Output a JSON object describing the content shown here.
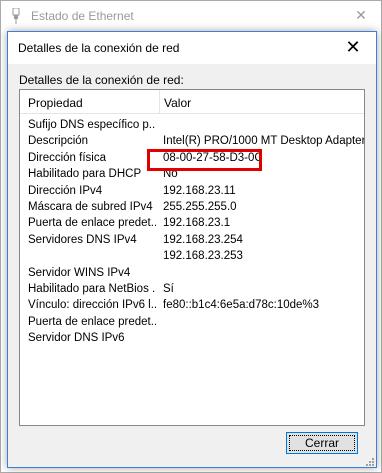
{
  "parent_window": {
    "title": "Estado de Ethernet",
    "close_glyph": "✕"
  },
  "dialog": {
    "title": "Detalles de la conexión de red",
    "close_glyph": "✕",
    "group_label": "Detalles de la conexión de red:",
    "columns": {
      "property": "Propiedad",
      "value": "Valor"
    },
    "rows": [
      {
        "property": "Sufijo DNS específico p...",
        "value": ""
      },
      {
        "property": "Descripción",
        "value": "Intel(R) PRO/1000 MT Desktop Adapter"
      },
      {
        "property": "Dirección física",
        "value": "08-00-27-58-D3-0C"
      },
      {
        "property": "Habilitado para DHCP",
        "value": "No"
      },
      {
        "property": "Dirección IPv4",
        "value": "192.168.23.11"
      },
      {
        "property": "Máscara de subred IPv4",
        "value": "255.255.255.0"
      },
      {
        "property": "Puerta de enlace predet...",
        "value": "192.168.23.1"
      },
      {
        "property": "Servidores DNS IPv4",
        "value": "192.168.23.254"
      },
      {
        "property": "",
        "value": "192.168.23.253"
      },
      {
        "property": "Servidor WINS IPv4",
        "value": ""
      },
      {
        "property": "Habilitado para NetBios ...",
        "value": "Sí"
      },
      {
        "property": "Vínculo: dirección IPv6 l...",
        "value": "fe80::b1c4:6e5a:d78c:10de%3"
      },
      {
        "property": "Puerta de enlace predet...",
        "value": ""
      },
      {
        "property": "Servidor DNS IPv6",
        "value": ""
      }
    ],
    "close_button": "Cerrar",
    "highlight_color": "#e00000",
    "accent_color": "#0078d7"
  }
}
